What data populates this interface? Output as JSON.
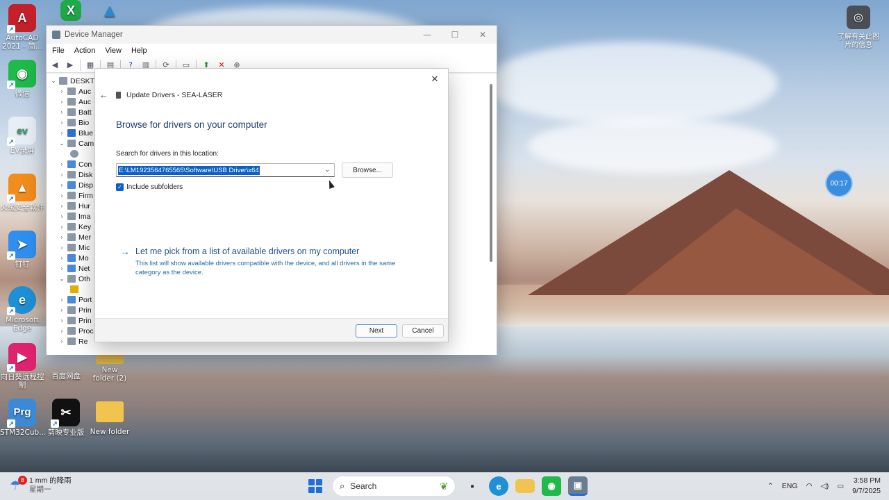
{
  "desktop": {
    "icons": [
      {
        "label": "AutoCAD 2021 - 简...",
        "color": "#c3202a",
        "glyph": "A"
      },
      {
        "label": "微信",
        "color": "#1fba4a",
        "glyph": "W"
      },
      {
        "label": "EV录屏",
        "color": "#e7eef5",
        "glyph": "ev"
      },
      {
        "label": "火绒安全软件",
        "color": "#f28c1d",
        "glyph": "火"
      },
      {
        "label": "钉钉",
        "color": "#2f8ff0",
        "glyph": "钉"
      },
      {
        "label": "Microsoft Edge",
        "color": "#1f8fd6",
        "glyph": "e"
      },
      {
        "label": "向日葵远程控制",
        "color": "#e0236e",
        "glyph": "▶"
      },
      {
        "label": "STM32Cub...",
        "color": "#3b8ad8",
        "glyph": "Prg"
      },
      {
        "label": "百度网盘",
        "color": "#2e7be6",
        "glyph": "∞"
      },
      {
        "label": "New folder (2)",
        "color": "#f1c44f",
        "glyph": ""
      },
      {
        "label": "剪映专业版",
        "color": "#111111",
        "glyph": "✂"
      },
      {
        "label": "New folder",
        "color": "#f1c44f",
        "glyph": ""
      }
    ],
    "top_right_label": "了解有关此图片的信息",
    "timer": "00:17"
  },
  "device_manager": {
    "title": "Device Manager",
    "menu": [
      "File",
      "Action",
      "View",
      "Help"
    ],
    "tree_root": "DESKTO",
    "tree_items": [
      "Auc",
      "Auc",
      "Batt",
      "Bio",
      "Blue",
      "Cam",
      "",
      "Con",
      "Disk",
      "Disp",
      "Firm",
      "Hur",
      "Ima",
      "Key",
      "Mer",
      "Mic",
      "Mo",
      "Net",
      "Oth",
      "",
      "Port",
      "Prin",
      "Prin",
      "Proc",
      "Re"
    ]
  },
  "wizard": {
    "header": "Update Drivers - SEA-LASER",
    "heading": "Browse for drivers on your computer",
    "search_label": "Search for drivers in this location:",
    "path_value": "E:\\LM1923564765565\\Software\\USB Driver\\x64",
    "browse_label": "Browse...",
    "include_subfolders_label": "Include subfolders",
    "include_subfolders_checked": true,
    "pick_link": "Let me pick from a list of available drivers on my computer",
    "pick_desc": "This list will show available drivers compatible with the device, and all drivers in the same category as the device.",
    "next_label": "Next",
    "cancel_label": "Cancel"
  },
  "taskbar": {
    "weather_badge": "8",
    "weather_line1": "1 mm 的降雨",
    "weather_line2": "星期一",
    "search_placeholder": "Search",
    "lang": "ENG",
    "time": "3:58 PM",
    "date": "9/7/2025"
  }
}
